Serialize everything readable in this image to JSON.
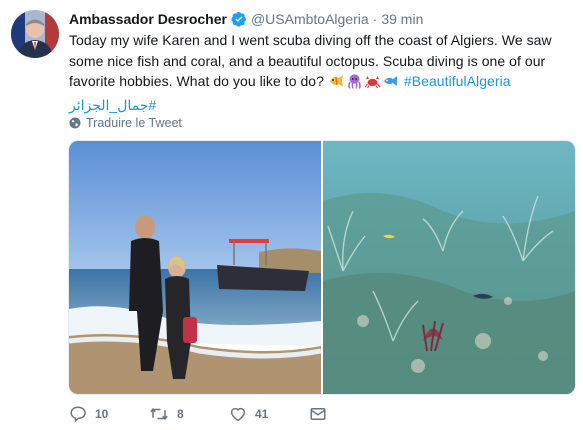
{
  "tweet": {
    "author_name": "Ambassador Desrocher",
    "handle": "@USAmbtoAlgeria",
    "separator": "·",
    "time": "39 min",
    "text_line1": "Today my wife Karen and I went scuba diving off the coast of Algiers. We saw",
    "text_line2": "some nice fish and coral, and a beautiful octopus. Scuba diving is one of our",
    "text_line3": "favorite hobbies. What do you like to do?",
    "emojis": [
      "tropical-fish-emoji",
      "octopus-emoji",
      "crab-emoji",
      "fish-emoji"
    ],
    "hashtag_en": "#BeautifulAlgeria",
    "hashtag_ar": "#جمال_الجزائر",
    "translate_label": "Traduire le Tweet"
  },
  "photos": [
    {
      "description_icon": "couple-beach-photo"
    },
    {
      "description_icon": "underwater-coral-photo"
    }
  ],
  "actions": {
    "reply_count": "10",
    "retweet_count": "8",
    "like_count": "41"
  },
  "colors": {
    "link": "#1b95e0",
    "secondary_text": "#657786",
    "verified": "#1da1f2"
  }
}
